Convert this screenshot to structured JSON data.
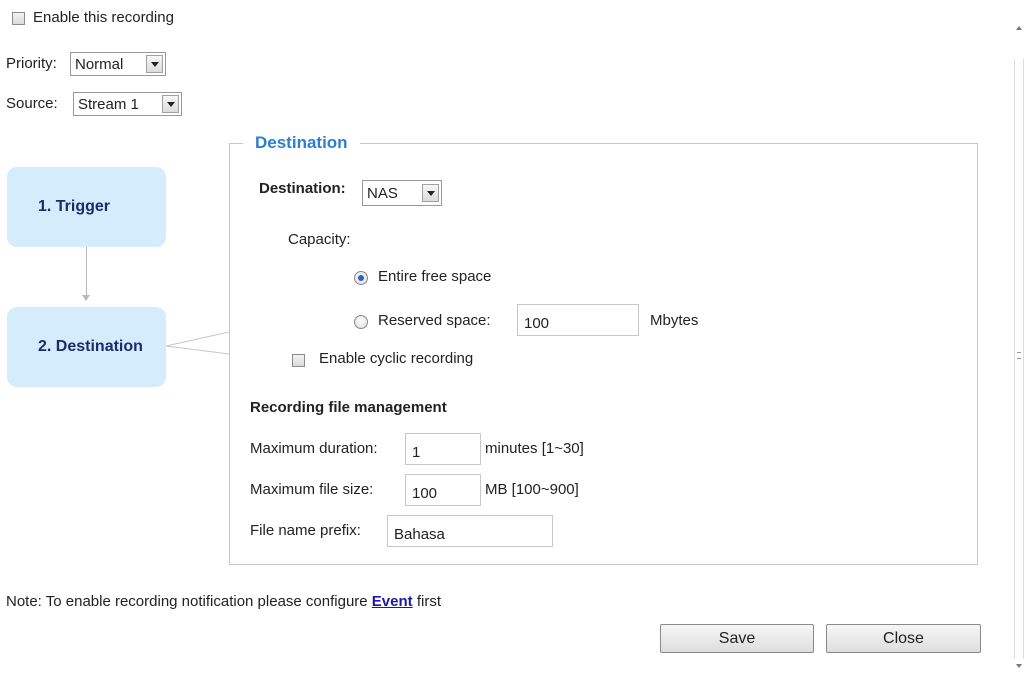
{
  "enable_recording": {
    "label": "Enable this recording",
    "checked": false
  },
  "priority": {
    "label": "Priority:",
    "value": "Normal"
  },
  "source": {
    "label": "Source:",
    "value": "Stream 1"
  },
  "steps": [
    {
      "label": "1.  Trigger"
    },
    {
      "label": "2.  Destination"
    }
  ],
  "destination_panel": {
    "legend": "Destination",
    "destination_label": "Destination:",
    "destination_value": "NAS",
    "capacity_label": "Capacity:",
    "entire_free_space": {
      "label": "Entire free space",
      "selected": true
    },
    "reserved_space": {
      "label": "Reserved space:",
      "value": "100",
      "unit": "Mbytes",
      "selected": false
    },
    "cyclic": {
      "label": "Enable cyclic recording",
      "checked": false
    }
  },
  "file_management": {
    "heading": "Recording file management",
    "max_duration": {
      "label": "Maximum duration:",
      "value": "1",
      "hint": "minutes [1~30]"
    },
    "max_file_size": {
      "label": "Maximum file size:",
      "value": "100",
      "hint": "MB [100~900]"
    },
    "prefix": {
      "label": "File name prefix:",
      "value": "Bahasa"
    }
  },
  "note": {
    "text": "Note: To enable recording notification please configure ",
    "link": "Event",
    "suffix": " first"
  },
  "buttons": {
    "save": "Save",
    "close": "Close"
  },
  "colors": {
    "accent": "#2a7fd0",
    "step_bg": "#d4ecfb",
    "step_text": "#1a2d6b",
    "link": "#1a1aa6"
  }
}
